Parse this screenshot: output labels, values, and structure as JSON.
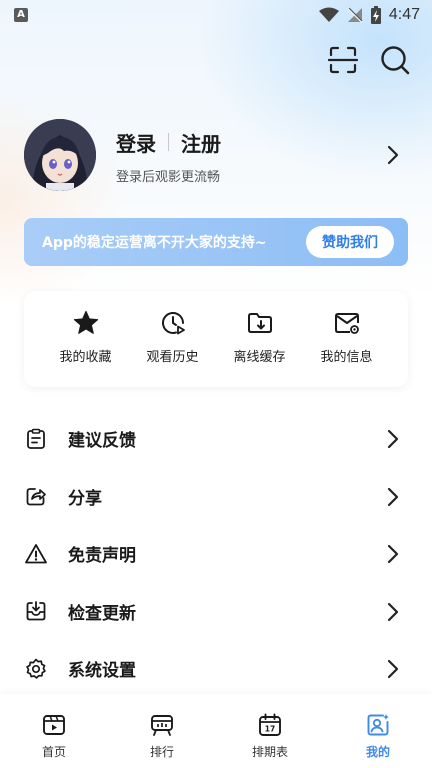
{
  "status_bar": {
    "time": "4:47",
    "left_icon_text": "A"
  },
  "header": {
    "icons": [
      "scan-icon",
      "search-icon"
    ]
  },
  "profile": {
    "login": "登录",
    "register": "注册",
    "subtitle": "登录后观影更流畅"
  },
  "banner": {
    "text": "App的稳定运营离不开大家的支持~",
    "button": "赞助我们"
  },
  "quick_actions": [
    {
      "label": "我的收藏",
      "icon": "star-icon"
    },
    {
      "label": "观看历史",
      "icon": "history-icon"
    },
    {
      "label": "离线缓存",
      "icon": "download-folder-icon"
    },
    {
      "label": "我的信息",
      "icon": "message-icon"
    }
  ],
  "menu": [
    {
      "label": "建议反馈",
      "icon": "feedback-icon"
    },
    {
      "label": "分享",
      "icon": "share-icon"
    },
    {
      "label": "免责声明",
      "icon": "warning-icon"
    },
    {
      "label": "检查更新",
      "icon": "update-icon"
    },
    {
      "label": "系统设置",
      "icon": "settings-icon"
    }
  ],
  "bottom_nav": [
    {
      "label": "首页",
      "icon": "home-icon",
      "active": false
    },
    {
      "label": "排行",
      "icon": "ranking-icon",
      "active": false
    },
    {
      "label": "排期表",
      "icon": "calendar-icon",
      "active": false
    },
    {
      "label": "我的",
      "icon": "profile-icon",
      "active": true
    }
  ],
  "colors": {
    "accent": "#3d8be8",
    "banner": "#9cc6f6",
    "text": "#1a1a1a"
  }
}
